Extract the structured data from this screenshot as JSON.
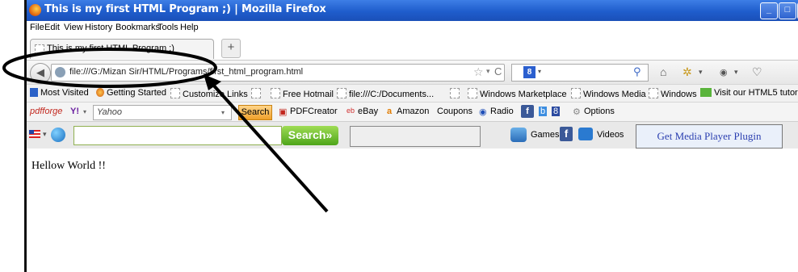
{
  "window": {
    "title": "This is my first HTML Program ;) | Mozilla Firefox",
    "controls": {
      "minimize": "_",
      "maximize": "□",
      "close": ""
    }
  },
  "menu": [
    "File",
    "Edit",
    "View",
    "History",
    "Bookmarks",
    "Tools",
    "Help"
  ],
  "tabs": [
    {
      "label": "This is my first HTML Program ;)"
    }
  ],
  "new_tab_label": "+",
  "navbar": {
    "back": "◀",
    "url": "file:///G:/Mizan Sir/HTML/Programs/first_html_program.html",
    "star": "☆",
    "dropdown": "▾",
    "reload": "C",
    "search_engine_letter": "8",
    "search_dd": "▾",
    "search_icon": "⚲",
    "home": "⌂",
    "tools": [
      "✲",
      "▾",
      "◉",
      "▾",
      "♡"
    ]
  },
  "bookmarks": [
    {
      "label": "Most Visited",
      "icon": "blue"
    },
    {
      "label": "Getting Started",
      "icon": "ff"
    },
    {
      "label": "Customize Links",
      "icon": "page"
    },
    {
      "label": "",
      "icon": "page"
    },
    {
      "label": "Free Hotmail",
      "icon": "page"
    },
    {
      "label": "file:///C:/Documents...",
      "icon": "page"
    },
    {
      "label": "",
      "icon": "page"
    },
    {
      "label": "Windows Marketplace",
      "icon": "page"
    },
    {
      "label": "Windows Media",
      "icon": "page"
    },
    {
      "label": "Windows",
      "icon": "page"
    },
    {
      "label": "Visit our HTML5 tutor",
      "icon": "green"
    }
  ],
  "toolbar2": {
    "pdfforge": "pdfforge",
    "yahoo_badge": "Y!",
    "yahoo_dd": "▾",
    "yahoo_placeholder": "Yahoo",
    "yahoo_field_dd": "▾",
    "search": "Search",
    "pdfcreator": "PDFCreator",
    "ebay": "eBay",
    "amazon": "Amazon",
    "coupons": "Coupons",
    "radio": "Radio",
    "options": "Options"
  },
  "toolbar3": {
    "search_button": "Search»",
    "games": "Games",
    "videos": "Videos",
    "media_plugin": "Get Media Player Plugin"
  },
  "content": {
    "text": "Hellow World !!"
  }
}
